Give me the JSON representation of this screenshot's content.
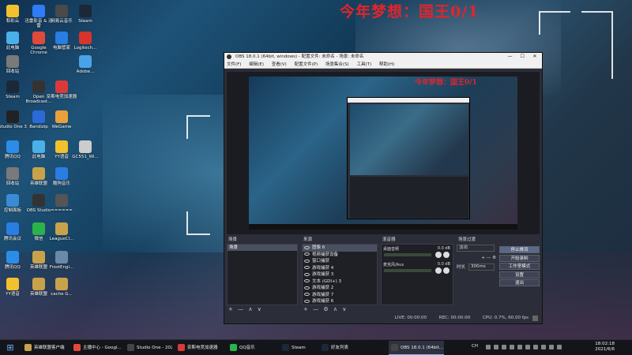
{
  "overlay": {
    "title": "今年梦想：国王0/1"
  },
  "desktop_icons": [
    {
      "label": "和彩云",
      "color": "#f2c12e"
    },
    {
      "label": "迅雷影音 & 迅雷",
      "color": "#2f7df6"
    },
    {
      "label": "网易云音乐",
      "color": "#4a4a4a"
    },
    {
      "label": "Steam",
      "color": "#1b2838"
    },
    {
      "label": "此电脑",
      "color": "#4ab0e8"
    },
    {
      "label": "Google Chrome",
      "color": "#e04a3a"
    },
    {
      "label": "电脑管家",
      "color": "#2a7de1"
    },
    {
      "label": "Logitech...",
      "color": "#d6342c"
    },
    {
      "label": "Adobe...",
      "color": "#4aa3e8"
    },
    {
      "label": "回收站",
      "color": "#7a7a7a"
    },
    {
      "label": "Steam",
      "color": "#1b2838"
    },
    {
      "label": "Open Broadcast...",
      "color": "#333333"
    },
    {
      "label": "奈斯电竞加速器",
      "color": "#d83a3a"
    },
    {
      "label": "Studio One 3",
      "color": "#222222"
    },
    {
      "label": "Bandizip",
      "color": "#2b6ad8"
    },
    {
      "label": "WeGame",
      "color": "#e8a13a"
    },
    {
      "label": "腾讯QQ",
      "color": "#2c8de8"
    },
    {
      "label": "此电脑",
      "color": "#4ab0e8"
    },
    {
      "label": "YY语音",
      "color": "#f2c12e"
    },
    {
      "label": "GC551_Wi...",
      "color": "#cccccc"
    },
    {
      "label": "回收站",
      "color": "#7a7a7a"
    },
    {
      "label": "英雄联盟",
      "color": "#c8a24a"
    },
    {
      "label": "酷狗音乐",
      "color": "#2a7de1"
    },
    {
      "label": "控制面板",
      "color": "#3a8ad8"
    },
    {
      "label": "OBS Studio",
      "color": "#333333"
    },
    {
      "label": "======",
      "color": "#555555"
    },
    {
      "label": "腾讯会议",
      "color": "#2a7de1"
    },
    {
      "label": "微信",
      "color": "#2bb24c"
    },
    {
      "label": "LeagueCl...",
      "color": "#c8a24a"
    },
    {
      "label": "腾讯QQ",
      "color": "#2c8de8"
    },
    {
      "label": "英雄联盟",
      "color": "#c8a24a"
    },
    {
      "label": "FrostEngi...",
      "color": "#6a8aa8"
    },
    {
      "label": "YY语音",
      "color": "#f2c12e"
    },
    {
      "label": "英雄联盟",
      "color": "#c8a24a"
    },
    {
      "label": "cache G...",
      "color": "#c8a24a"
    }
  ],
  "obs": {
    "title": "OBS 18.0.1 (64bit, windows) - 配置文件: 未命名 - 场景: 未命名",
    "window_buttons": [
      "—",
      "☐",
      "✕"
    ],
    "menu": [
      "文件(F)",
      "编辑(E)",
      "查看(V)",
      "配置文件(P)",
      "场景集合(S)",
      "工具(T)",
      "帮助(H)"
    ],
    "preview_text": "今年梦想：国王0/1",
    "docks": {
      "scenes": {
        "title": "场景",
        "items": [
          "场景"
        ],
        "footer": [
          "+",
          "—",
          "∧",
          "∨"
        ]
      },
      "sources": {
        "title": "来源",
        "items": [
          "图像 6",
          "视频捕获设备",
          "窗口捕获",
          "游戏捕获 4",
          "游戏捕获 3",
          "文本 (GDI+) 3",
          "游戏捕获 2",
          "游戏捕获 7",
          "游戏捕获 6"
        ],
        "footer": [
          "+",
          "—",
          "⚙",
          "∧",
          "∨"
        ]
      },
      "mixer": {
        "title": "混音器",
        "channels": [
          {
            "name": "桌面音频",
            "db": "0.0 dB"
          },
          {
            "name": "麦克风/Aux",
            "db": "0.0 dB"
          }
        ]
      },
      "transitions": {
        "title": "场景过渡",
        "mode": "淡出",
        "duration_label": "时长",
        "duration": "300ms",
        "footer": [
          "+",
          "—",
          "⚙"
        ]
      },
      "controls": {
        "buttons": [
          "停止推流",
          "开始录制",
          "工作室模式",
          "设置",
          "退出"
        ]
      }
    },
    "status": {
      "live": "LIVE: 00:00:00",
      "rec": "REC: 00:00:00",
      "cpu": "CPU: 0.7%, 60.00 fps"
    }
  },
  "taskbar": {
    "start_icon": "windows-icon",
    "items": [
      {
        "label": "英雄联盟客户端",
        "color": "#c8a24a"
      },
      {
        "label": "主播中心 - Googl...",
        "color": "#e04a3a"
      },
      {
        "label": "Studio One - 202...",
        "color": "#444444"
      },
      {
        "label": "奈斯电竞加速器",
        "color": "#d83a3a"
      },
      {
        "label": "QQ音乐",
        "color": "#2bb24c"
      },
      {
        "label": "Steam",
        "color": "#1b2838"
      },
      {
        "label": "好友列表",
        "color": "#1b2838"
      },
      {
        "label": "OBS 18.0.1 (64bit...",
        "color": "#444444"
      }
    ],
    "ime": "CH",
    "time": "18:02:18",
    "date": "2021/6/6"
  }
}
